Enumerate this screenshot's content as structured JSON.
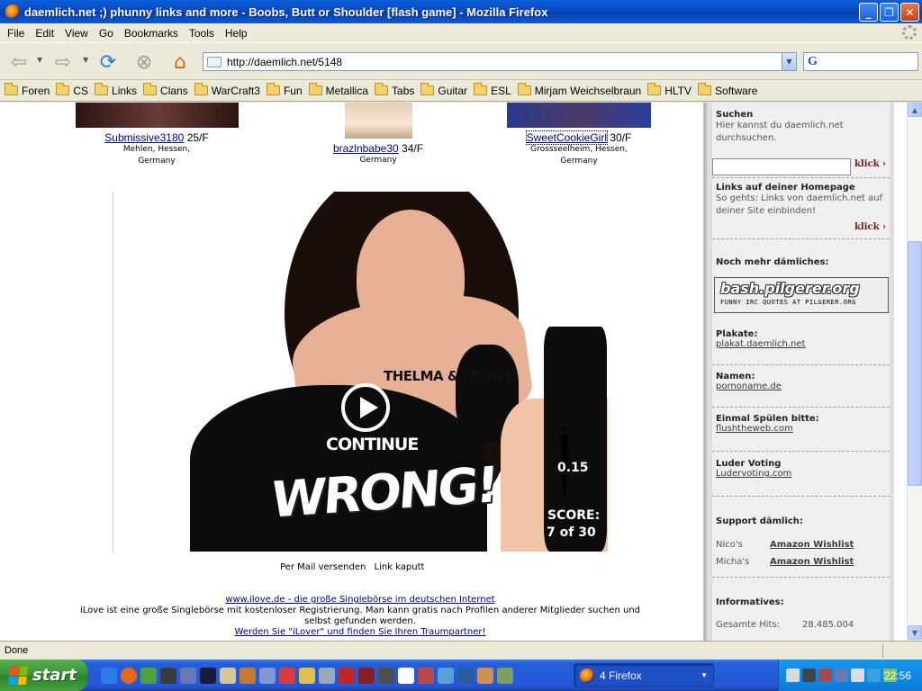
{
  "window": {
    "title": "daemlich.net ;) phunny links and more - Boobs, Butt or Shoulder [flash game] - Mozilla Firefox",
    "controls": {
      "minimize": "_",
      "maximize": "❐",
      "close": "✕"
    }
  },
  "menu": [
    "File",
    "Edit",
    "View",
    "Go",
    "Bookmarks",
    "Tools",
    "Help"
  ],
  "toolbar": {
    "url": "http://daemlich.net/5148",
    "search_placeholder": ""
  },
  "bookmarks": [
    "Foren",
    "CS",
    "Links",
    "Clans",
    "WarCraft3",
    "Fun",
    "Metallica",
    "Tabs",
    "Guitar",
    "ESL",
    "Mirjam Weichselbraun",
    "HLTV",
    "Software"
  ],
  "profiles": [
    {
      "name": "Submissive3180",
      "age": "25/F",
      "location_line1": "Mehlen, Hessen,",
      "location_line2": "Germany"
    },
    {
      "name": "brazlnbabe30",
      "age": "34/F",
      "location_line1": "",
      "location_line2": "Germany"
    },
    {
      "name": "SweetCookieGirl",
      "age": "30/F",
      "location_line1": "Grossseelheim, Hessen,",
      "location_line2": "Germany"
    }
  ],
  "game": {
    "movie_title": "THELMA & LOUISE",
    "continue_label": "CONTINUE",
    "result": "WRONG!",
    "timer": "0.15",
    "score_label": "SCORE:",
    "score_value": "7 of 30"
  },
  "actions": {
    "mail": "Per Mail versenden",
    "broken": "Link kaputt"
  },
  "ad": {
    "link": "www.ilove.de - die große Singlebörse im deutschen Internet",
    "text": "iLove ist eine große Singlebörse mit kostenloser Registrierung. Man kann gratis nach Profilen anderer Mitglieder suchen und selbst gefunden werden.",
    "cta": "Werden Sie \"iLover\" und finden Sie Ihren Traumpartner!"
  },
  "sidebar": {
    "search_title": "Suchen",
    "search_text": "Hier kannst du daemlich.net durchsuchen.",
    "klick": "klick",
    "links_title": "Links auf deiner Homepage",
    "links_text": "So gehts: Links von daemlich.net auf deiner Site einbinden!",
    "more_title": "Noch mehr dämliches:",
    "bash_title": "bash.pilgerer.org",
    "bash_sub": "FUNNY IRC QUOTES AT PILGERER.ORG",
    "plakat_title": "Plakate:",
    "plakat_link": "plakat.daemlich.net",
    "namen_title": "Namen:",
    "namen_link": "pornoname.de",
    "flush_title": "Einmal Spülen bitte:",
    "flush_link": "flushtheweb.com",
    "luder_title": "Luder Voting",
    "luder_link": "Ludervoting.com",
    "support_title": "Support dämlich:",
    "wishlists": [
      {
        "name": "Nico's",
        "link": "Amazon Wishlist"
      },
      {
        "name": "Micha's",
        "link": "Amazon Wishlist"
      }
    ],
    "info_title": "Informatives:",
    "hits_label": "Gesamte Hits:",
    "hits_value": "28.485.004"
  },
  "status": {
    "text": "Done"
  },
  "taskbar": {
    "start_label": "start",
    "task_label": "4 Firefox",
    "clock": "22:56"
  },
  "colors": {
    "titlebar": "#0949c4",
    "taskbar": "#245edb",
    "start": "#3b9436",
    "link": "#00008b",
    "klick": "#7a1818"
  }
}
